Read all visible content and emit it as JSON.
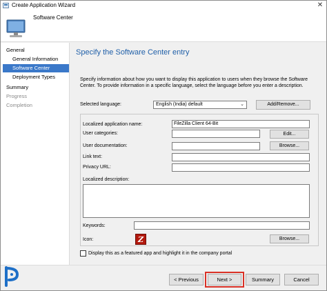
{
  "window": {
    "title": "Create Application Wizard",
    "close_label": "✕"
  },
  "header": {
    "text": "Software Center"
  },
  "nav": {
    "general": "General",
    "general_information": "General Information",
    "software_center": "Software Center",
    "deployment_types": "Deployment Types",
    "summary": "Summary",
    "progress": "Progress",
    "completion": "Completion"
  },
  "page": {
    "title": "Specify the Software Center entry",
    "description": "Specify information about how you want to display this application to users when they browse the Software Center. To provide information in a specific language, select the language before you enter a description."
  },
  "form": {
    "selected_language_label": "Selected language:",
    "selected_language_value": "English (India) default",
    "add_remove_label": "Add/Remove...",
    "localized_name_label": "Localized application name:",
    "localized_name_value": "FileZilla Client 64-Bit",
    "user_categories_label": "User categories:",
    "user_categories_value": "",
    "edit_label": "Edit...",
    "user_documentation_label": "User documentation:",
    "user_documentation_value": "",
    "browse_label": "Browse...",
    "link_text_label": "Link text:",
    "link_text_value": "",
    "privacy_url_label": "Privacy URL:",
    "privacy_url_value": "",
    "localized_description_label": "Localized description:",
    "keywords_label": "Keywords:",
    "keywords_value": "",
    "icon_label": "Icon:",
    "icon_browse_label": "Browse...",
    "icon_glyph": "Z",
    "featured_label": "Display this as a featured app and highlight it in the company portal"
  },
  "footer": {
    "previous_label": "< Previous",
    "next_label": "Next >",
    "summary_label": "Summary",
    "cancel_label": "Cancel"
  },
  "colors": {
    "accent": "#3a78c9",
    "title_blue": "#1f5fa8",
    "highlight_red": "#d93025",
    "filezilla_red": "#b3190e"
  }
}
